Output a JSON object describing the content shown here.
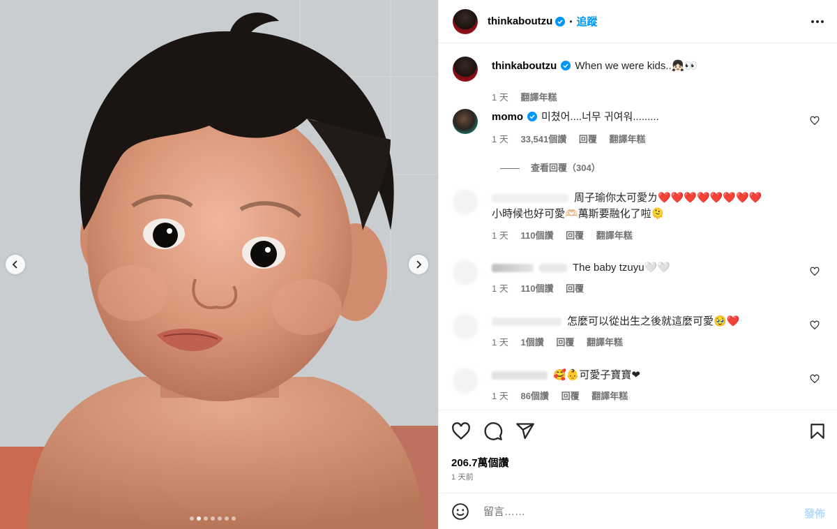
{
  "post": {
    "author": "thinkaboutzu",
    "follow_label": "追蹤",
    "separator": "•",
    "caption": "When we were kids..👧🏻👀",
    "caption_age": "1 天",
    "caption_translate": "翻譯年糕",
    "likes": "206.7萬個讚",
    "posted_ago": "1 天前",
    "carousel": {
      "total": 7,
      "active_index": 1
    }
  },
  "comments": [
    {
      "user": "momo",
      "verified": true,
      "text": "미쳤어....너무 귀여워.........",
      "age": "1 天",
      "likes": "33,541個讚",
      "reply": "回覆",
      "translate": "翻譯年糕",
      "view_replies": "查看回覆（304）"
    },
    {
      "user": "",
      "verified": false,
      "text_line1": "周子瑜你太可愛ㄌ❤️❤️❤️❤️❤️❤️❤️❤️",
      "text_line2": "小時候也好可愛🫶🏻萬斯要融化了啦🫠",
      "age": "1 天",
      "likes": "110個讚",
      "reply": "回覆",
      "translate": "翻譯年糕"
    },
    {
      "user": "",
      "verified": false,
      "text": "The baby tzuyu🤍🤍",
      "age": "1 天",
      "likes": "110個讚",
      "reply": "回覆"
    },
    {
      "user": "",
      "verified": false,
      "text": "怎麼可以從出生之後就這麼可愛🥹❤️",
      "age": "1 天",
      "likes": "1個讚",
      "reply": "回覆",
      "translate": "翻譯年糕"
    },
    {
      "user": "",
      "verified": false,
      "text": "🥰👶可愛子寶寶❤",
      "age": "1 天",
      "likes": "86個讚",
      "reply": "回覆",
      "translate": "翻譯年糕"
    }
  ],
  "composer": {
    "placeholder": "留言……",
    "post_label": "發佈"
  },
  "colors": {
    "accent": "#0095f6",
    "verified": "#0095f6",
    "muted": "#737373",
    "post_disabled": "#b3dbff"
  },
  "icons": [
    "chevron-left-icon",
    "chevron-right-icon",
    "more-icon",
    "verified-icon",
    "heart-icon",
    "comment-icon",
    "share-icon",
    "bookmark-icon",
    "emoji-icon"
  ]
}
